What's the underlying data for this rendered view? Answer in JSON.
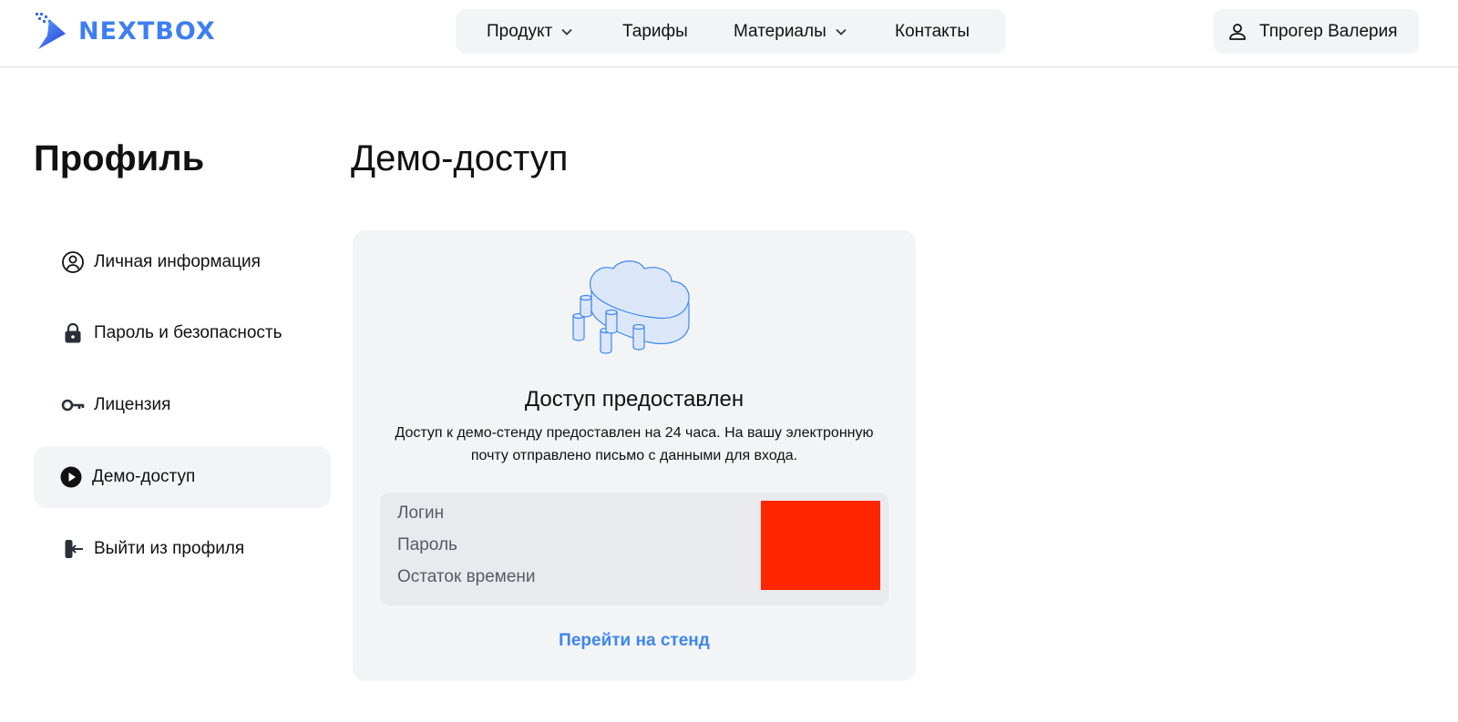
{
  "header": {
    "logo_text": "NEXTBOX",
    "nav": {
      "product": "Продукт",
      "tariffs": "Тарифы",
      "materials": "Материалы",
      "contacts": "Контакты"
    },
    "user_name": "Тпрогер Валерия"
  },
  "sidebar": {
    "title": "Профиль",
    "items": [
      {
        "label": "Личная информация",
        "icon": "user-circle-icon"
      },
      {
        "label": "Пароль и безопасность",
        "icon": "lock-icon"
      },
      {
        "label": "Лицензия",
        "icon": "key-icon"
      },
      {
        "label": "Демо-доступ",
        "icon": "play-circle-icon",
        "active": true
      },
      {
        "label": "Выйти из профиля",
        "icon": "logout-icon"
      }
    ]
  },
  "main": {
    "title": "Демо-доступ",
    "card": {
      "illustration": "cloud-storage-icon",
      "title": "Доступ предоставлен",
      "description": "Доступ к демо-стенду предоставлен на 24 часа. На вашу электронную почту отправлено письмо с данными для входа.",
      "credentials": {
        "login_label": "Логин",
        "password_label": "Пароль",
        "time_left_label": "Остаток времени"
      },
      "go_link": "Перейти на стенд"
    }
  },
  "colors": {
    "accent": "#3d86f0",
    "logo": "#3d7ff0",
    "panel_bg": "#f3f4f6",
    "redaction": "#ff2600"
  }
}
